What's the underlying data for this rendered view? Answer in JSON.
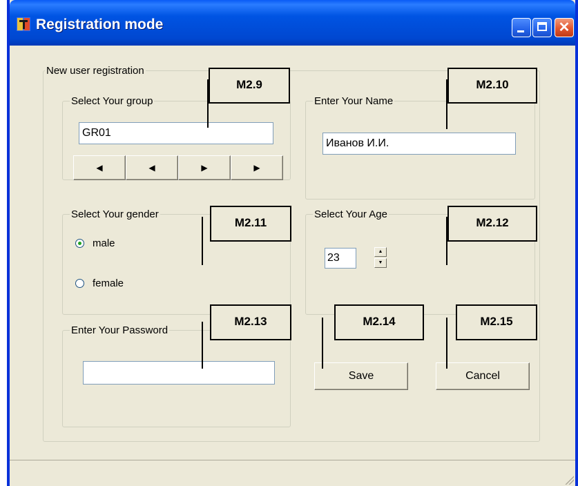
{
  "window": {
    "title": "Registration mode",
    "app_icon": "dev-app-icon",
    "title_color": "#0054e3"
  },
  "registration": {
    "group_label": "New user registration",
    "group_box": {
      "label": "Select Your group",
      "value": "GR01",
      "nav_buttons": [
        "first-record",
        "previous-record",
        "next-record",
        "last-record"
      ]
    },
    "name_box": {
      "label": "Enter Your Name",
      "value": "Иванов И.И."
    },
    "gender_box": {
      "label": "Select Your gender",
      "options": [
        {
          "label": "male",
          "selected": true
        },
        {
          "label": "female",
          "selected": false
        }
      ]
    },
    "age_box": {
      "label": "Select Your Age",
      "value": "23"
    },
    "password_box": {
      "label": "Enter Your Password",
      "value": ""
    },
    "save_label": "Save",
    "cancel_label": "Cancel"
  },
  "annotations": {
    "m9": "M2.9",
    "m10": "M2.10",
    "m11": "M2.11",
    "m12": "M2.12",
    "m13": "M2.13",
    "m14": "M2.14",
    "m15": "M2.15"
  }
}
